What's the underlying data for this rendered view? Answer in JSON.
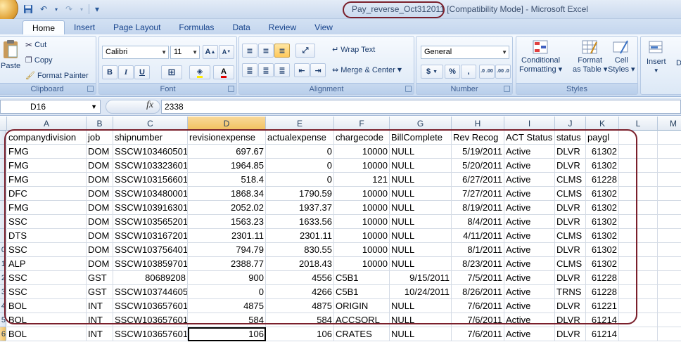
{
  "window": {
    "file_name": "Pay_reverse_Oct312011",
    "title_suffix": " [Compatibility Mode] - Microsoft Excel"
  },
  "quick_access": {
    "customize_label": "▾"
  },
  "tabs": [
    "Home",
    "Insert",
    "Page Layout",
    "Formulas",
    "Data",
    "Review",
    "View"
  ],
  "active_tab": "Home",
  "ribbon": {
    "clipboard": {
      "paste": "Paste",
      "cut": "Cut",
      "copy": "Copy",
      "format_painter": "Format Painter",
      "label": "Clipboard"
    },
    "font": {
      "name": "Calibri",
      "size": "11",
      "bold": "B",
      "italic": "I",
      "underline": "U",
      "grow": "A",
      "shrink": "A",
      "color_letter": "A",
      "label": "Font"
    },
    "alignment": {
      "wrap_text": "Wrap Text",
      "merge_center": "Merge & Center",
      "label": "Alignment"
    },
    "number": {
      "format": "General",
      "currency": "$",
      "percent": "%",
      "comma": ",",
      "inc_decimal": ".0 .00",
      "dec_decimal": ".00 .0",
      "label": "Number"
    },
    "styles": {
      "conditional": "Conditional",
      "conditional2": "Formatting",
      "format_table": "Format",
      "format_table2": "as Table",
      "cell_styles": "Cell",
      "cell_styles2": "Styles",
      "label": "Styles"
    },
    "cells": {
      "insert": "Insert",
      "delete": "D"
    }
  },
  "formula_bar": {
    "name_box": "D16",
    "fx": "fx",
    "content": "2338"
  },
  "columns": [
    "A",
    "B",
    "C",
    "D",
    "E",
    "F",
    "G",
    "H",
    "I",
    "J",
    "K",
    "L",
    "M"
  ],
  "selected_column": "D",
  "row_numbers": [
    "",
    "",
    "",
    "",
    "",
    "",
    "",
    "",
    "0",
    "1",
    "2",
    "3",
    "4",
    "5",
    "6"
  ],
  "header_row": [
    "companydivision",
    "job",
    "shipnumber",
    "revisionexpense",
    "actualexpense",
    "chargecode",
    "BillComplete",
    "Rev Recog",
    "ACT Status",
    "status",
    "paygl"
  ],
  "rows": [
    [
      "FMG",
      "DOM",
      "SSCW103460501",
      "697.67",
      "0",
      "10000",
      "NULL",
      "5/19/2011",
      "Active",
      "DLVR",
      "61302"
    ],
    [
      "FMG",
      "DOM",
      "SSCW103323601",
      "1964.85",
      "0",
      "10000",
      "NULL",
      "5/20/2011",
      "Active",
      "DLVR",
      "61302"
    ],
    [
      "FMG",
      "DOM",
      "SSCW103156601",
      "518.4",
      "0",
      "121",
      "NULL",
      "6/27/2011",
      "Active",
      "CLMS",
      "61228"
    ],
    [
      "DFC",
      "DOM",
      "SSCW103480001",
      "1868.34",
      "1790.59",
      "10000",
      "NULL",
      "7/27/2011",
      "Active",
      "CLMS",
      "61302"
    ],
    [
      "FMG",
      "DOM",
      "SSCW103916301",
      "2052.02",
      "1937.37",
      "10000",
      "NULL",
      "8/19/2011",
      "Active",
      "DLVR",
      "61302"
    ],
    [
      "SSC",
      "DOM",
      "SSCW103565201",
      "1563.23",
      "1633.56",
      "10000",
      "NULL",
      "8/4/2011",
      "Active",
      "DLVR",
      "61302"
    ],
    [
      "DTS",
      "DOM",
      "SSCW103167201",
      "2301.11",
      "2301.11",
      "10000",
      "NULL",
      "4/11/2011",
      "Active",
      "CLMS",
      "61302"
    ],
    [
      "SSC",
      "DOM",
      "SSCW103756401",
      "794.79",
      "830.55",
      "10000",
      "NULL",
      "8/1/2011",
      "Active",
      "DLVR",
      "61302"
    ],
    [
      "ALP",
      "DOM",
      "SSCW103859701",
      "2388.77",
      "2018.43",
      "10000",
      "NULL",
      "8/23/2011",
      "Active",
      "CLMS",
      "61302"
    ],
    [
      "SSC",
      "GST",
      "80689208",
      "900",
      "4556",
      "C5B1",
      "9/15/2011",
      "7/5/2011",
      "Active",
      "DLVR",
      "61228"
    ],
    [
      "SSC",
      "GST",
      "SSCW103744605",
      "0",
      "4266",
      "C5B1",
      "10/24/2011",
      "8/26/2011",
      "Active",
      "TRNS",
      "61228"
    ],
    [
      "BOL",
      "INT",
      "SSCW103657601",
      "4875",
      "4875",
      "ORIGIN",
      "NULL",
      "7/6/2011",
      "Active",
      "DLVR",
      "61221"
    ],
    [
      "BOL",
      "INT",
      "SSCW103657601",
      "584",
      "584",
      "ACCSORL",
      "NULL",
      "7/6/2011",
      "Active",
      "DLVR",
      "61214"
    ],
    [
      "BOL",
      "INT",
      "SSCW103657601",
      "106",
      "106",
      "CRATES",
      "NULL",
      "7/6/2011",
      "Active",
      "DLVR",
      "61214"
    ]
  ],
  "colors": {
    "accent": "#15428b",
    "annotation": "#7a1f2b",
    "selection": "#f1c15f"
  }
}
